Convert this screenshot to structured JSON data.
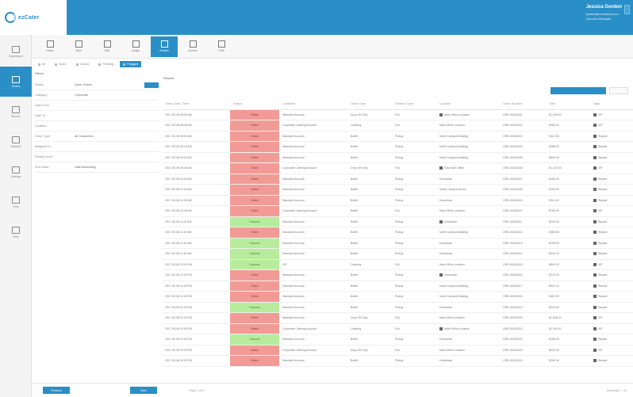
{
  "app": {
    "name": "ezCater"
  },
  "user": {
    "name": "Jessica Gordon",
    "lines": [
      "jessica@company.com",
      "Account Manager"
    ]
  },
  "sidenav": [
    {
      "label": "Dashboard",
      "icon": "dashboard-icon"
    },
    {
      "label": "Orders",
      "icon": "orders-icon",
      "active": true
    },
    {
      "label": "Reports",
      "icon": "reports-icon"
    },
    {
      "label": "Network",
      "icon": "network-icon"
    },
    {
      "label": "Settings",
      "icon": "settings-icon"
    },
    {
      "label": "Files",
      "icon": "files-icon"
    },
    {
      "label": "Help",
      "icon": "help-icon"
    }
  ],
  "toolbar": [
    {
      "label": "Home",
      "icon": "home-icon"
    },
    {
      "label": "New",
      "icon": "new-icon"
    },
    {
      "label": "Edit",
      "icon": "edit-icon"
    },
    {
      "label": "Assign",
      "icon": "assign-icon"
    },
    {
      "label": "Review",
      "icon": "review-icon",
      "active": true
    },
    {
      "label": "Archive",
      "icon": "archive-icon"
    },
    {
      "label": "Print",
      "icon": "print-icon"
    }
  ],
  "subtabs": [
    {
      "label": "All"
    },
    {
      "label": "Open"
    },
    {
      "label": "Closed"
    },
    {
      "label": "Pending"
    },
    {
      "label": "Flagged",
      "active": true
    }
  ],
  "filters": {
    "title": "Filters",
    "rows": [
      {
        "label": "Status",
        "value": "Open Orders",
        "go": true
      },
      {
        "label": "Category",
        "value": "Corporate"
      },
      {
        "label": "Date From",
        "value": ""
      },
      {
        "label": "Date To",
        "value": ""
      },
      {
        "label": "Location",
        "value": ""
      },
      {
        "label": "Order Type",
        "value": "All Customers"
      },
      {
        "label": "Assigned To",
        "value": ""
      },
      {
        "label": "Priority Level",
        "value": ""
      },
      {
        "label": "Sort Order",
        "value": "Date Ascending"
      }
    ]
  },
  "results_title": "Results",
  "table": {
    "columns": [
      "Order Date / Time",
      "Status",
      "Customer",
      "Order Type",
      "Delivery Type",
      "Location",
      "Order Number",
      "Total",
      "Tags"
    ],
    "rows": [
      [
        "2017-05-08 08:30 AM",
        "Failed",
        "Standard Account",
        "Drop Off Only",
        "Full",
        "Main Office Location",
        "ORD-00418201",
        "$1,245.00",
        "VIP"
      ],
      [
        "2017-05-08 08:45 AM",
        "Failed",
        "Corporate Catering Account",
        "Catering",
        "Full",
        "Main Office Location",
        "ORD-00418202",
        "$980.00",
        "VIP"
      ],
      [
        "2017-05-08 09:00 AM",
        "Failed",
        "Standard Account",
        "Buffet",
        "Pickup",
        "North Campus Building",
        "ORD-00418203",
        "$412.50",
        "Repeat"
      ],
      [
        "2017-05-08 09:15 AM",
        "Failed",
        "Standard Account",
        "Buffet",
        "Pickup",
        "North Campus Building",
        "ORD-00418204",
        "$388.00",
        "Repeat"
      ],
      [
        "2017-05-08 09:30 AM",
        "Failed",
        "Standard Account",
        "Buffet",
        "Pickup",
        "North Campus Building",
        "ORD-00418205",
        "$505.25",
        "Repeat"
      ],
      [
        "2017-05-08 09:45 AM",
        "Failed",
        "Corporate Catering Account",
        "Drop Off Only",
        "Full",
        "East Side Office",
        "ORD-00418206",
        "$1,120.00",
        "VIP"
      ],
      [
        "2017-05-08 10:00 AM",
        "Failed",
        "Standard Account",
        "Buffet",
        "Pickup",
        "Downtown",
        "ORD-00418207",
        "$265.00",
        "Repeat"
      ],
      [
        "2017-05-08 10:15 AM",
        "Failed",
        "Standard Account",
        "Buffet",
        "Pickup",
        "South Campus Annex",
        "ORD-00418208",
        "$299.90",
        "Repeat"
      ],
      [
        "2017-05-08 10:30 AM",
        "Failed",
        "Standard Account",
        "Buffet",
        "Pickup",
        "Downtown",
        "ORD-00418209",
        "$311.40",
        "Repeat"
      ],
      [
        "2017-05-08 10:45 AM",
        "Failed",
        "Corporate Catering Account",
        "Buffet",
        "Full",
        "Main Office Location",
        "ORD-00418210",
        "$760.00",
        "VIP"
      ],
      [
        "2017-05-08 11:00 AM",
        "Success",
        "Standard Account",
        "Buffet",
        "Pickup",
        "Downtown",
        "ORD-00418211",
        "$240.00",
        "Repeat"
      ],
      [
        "2017-05-08 11:15 AM",
        "Failed",
        "Standard Account",
        "Buffet",
        "Pickup",
        "North Campus Building",
        "ORD-00418212",
        "$355.60",
        "Repeat"
      ],
      [
        "2017-05-08 11:30 AM",
        "Success",
        "Standard Account",
        "Buffet",
        "Pickup",
        "Downtown",
        "ORD-00418213",
        "$198.00",
        "Repeat"
      ],
      [
        "2017-05-08 11:45 AM",
        "Success",
        "Standard Account",
        "Buffet",
        "Pickup",
        "Downtown",
        "ORD-00418214",
        "$224.75",
        "Repeat"
      ],
      [
        "2017-05-08 12:00 PM",
        "Success",
        "VIP",
        "Catering",
        "Full",
        "Main Office Location",
        "ORD-00418215",
        "$890.00",
        "VIP"
      ],
      [
        "2017-05-08 12:15 PM",
        "Failed",
        "Standard Account",
        "Buffet",
        "Pickup",
        "Downtown",
        "ORD-00418216",
        "$276.30",
        "Repeat"
      ],
      [
        "2017-05-08 12:30 PM",
        "Failed",
        "Standard Account",
        "Buffet",
        "Pickup",
        "North Campus Building",
        "ORD-00418217",
        "$341.10",
        "Repeat"
      ],
      [
        "2017-05-08 12:45 PM",
        "Failed",
        "Standard Account",
        "Buffet",
        "Pickup",
        "North Campus Building",
        "ORD-00418218",
        "$402.00",
        "Repeat"
      ],
      [
        "2017-05-08 01:00 PM",
        "Success",
        "Standard Account",
        "Buffet",
        "Pickup",
        "Downtown",
        "ORD-00418219",
        "$215.50",
        "Repeat"
      ],
      [
        "2017-05-08 01:15 PM",
        "Failed",
        "Standard Account",
        "Drop Off Only",
        "Full",
        "Main Office Location",
        "ORD-00418220",
        "$1,005.00",
        "VIP"
      ],
      [
        "2017-05-08 01:30 PM",
        "Failed",
        "Corporate Catering Account",
        "Catering",
        "Full",
        "Main Office Location",
        "ORD-00418221",
        "$1,340.00",
        "VIP"
      ],
      [
        "2017-05-08 01:45 PM",
        "Success",
        "Standard Account",
        "Buffet",
        "Pickup",
        "Downtown",
        "ORD-00418222",
        "$188.25",
        "Repeat"
      ],
      [
        "2017-05-08 02:00 PM",
        "Failed",
        "Corporate Catering Account",
        "Drop Off Only",
        "Full",
        "Main Office Location",
        "ORD-00418223",
        "$920.00",
        "VIP"
      ],
      [
        "2017-05-08 02:15 PM",
        "Failed",
        "Standard Account",
        "Buffet",
        "Pickup",
        "Downtown",
        "ORD-00418224",
        "$259.00",
        "Repeat"
      ]
    ]
  },
  "footer": {
    "left_button": "Previous",
    "right_button": "Next",
    "page_text": "Page 1 of 5",
    "summary": "Showing 1 - 24"
  },
  "colors": {
    "accent": "#2a8fc7",
    "failed": "#f29b96",
    "success": "#b7ec9c"
  }
}
